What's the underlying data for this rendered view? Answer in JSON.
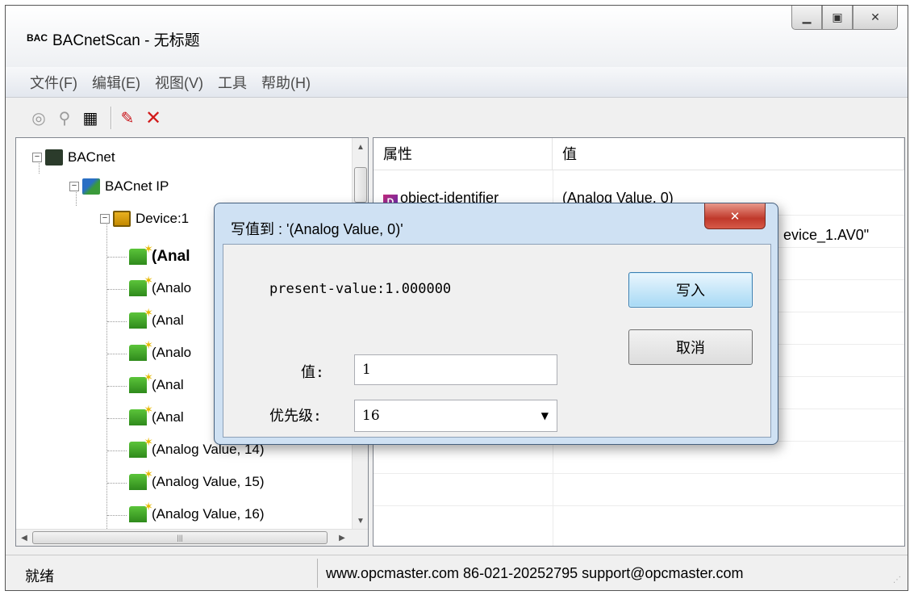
{
  "window": {
    "title": "BACnetScan - 无标题",
    "icon_text": "BAC"
  },
  "menu": [
    "文件(F)",
    "编辑(E)",
    "视图(V)",
    "工具",
    "帮助(H)"
  ],
  "toolbar": [
    "scan-icon",
    "find-icon",
    "properties-icon",
    "write-icon",
    "delete-icon"
  ],
  "tree": {
    "root": "BACnet",
    "ip": "BACnet IP",
    "device": "Device:1",
    "items": [
      "(Anal",
      "(Analo",
      "(Anal",
      "(Analo",
      "(Anal",
      "(Anal",
      "(Analog Value, 14)",
      "(Analog Value, 15)",
      "(Analog Value, 16)"
    ]
  },
  "list": {
    "columns": [
      "属性",
      "值"
    ],
    "rows": [
      {
        "prop": "object-identifier",
        "value": "(Analog Value, 0)"
      },
      {
        "prop": "",
        "value": "evice_1.AV0\""
      }
    ]
  },
  "status": {
    "left": "就绪",
    "right": "www.opcmaster.com 86-021-20252795 support@opcmaster.com"
  },
  "dialog": {
    "title": "写值到 : '(Analog Value, 0)'",
    "present_value": "present-value:1.000000",
    "value_label": "值:",
    "value": "1",
    "priority_label": "优先级:",
    "priority": "16",
    "write_button": "写入",
    "cancel_button": "取消"
  }
}
